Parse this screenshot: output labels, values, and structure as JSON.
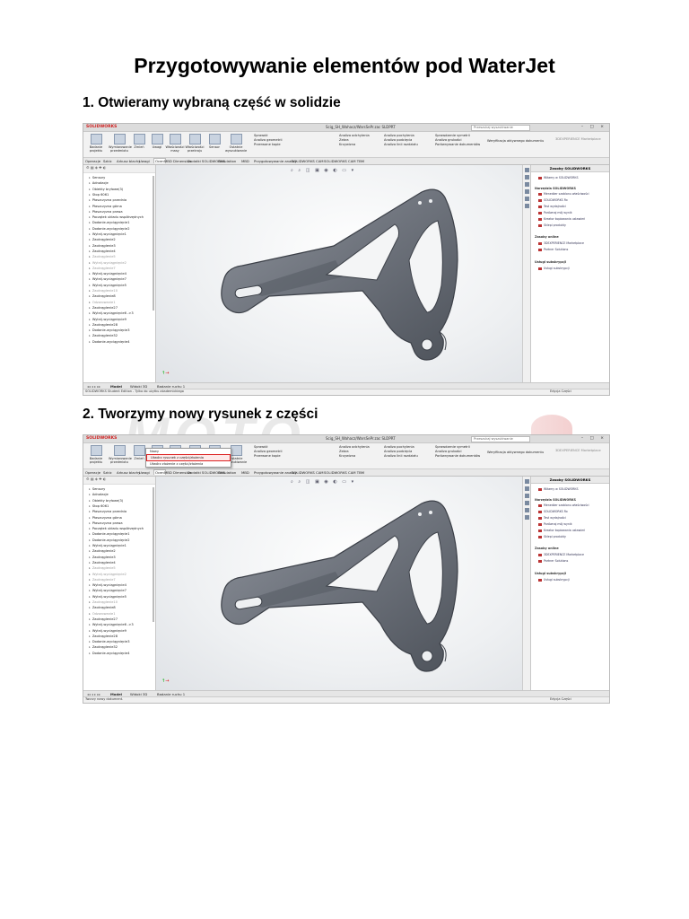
{
  "document": {
    "title": "Przygotowywanie elementów pod WaterJet",
    "steps": [
      {
        "heading": "1. Otwieramy wybraną część w solidzie"
      },
      {
        "heading": "2. Tworzymy nowy rysunek z części"
      }
    ],
    "watermark_text": "MOTO"
  },
  "app": {
    "logo": "SOLIDWORKS",
    "file_name": "Scig_SH_Wahacz/WarsSePr.zac SLDPRT",
    "search_placeholder": "Przeszukaj wyszukiwanie",
    "window_buttons": "– □ ×",
    "ribbon": {
      "big_buttons": [
        "Badanie projektu",
        "Wymiarowanie przedmiotu",
        "Zmień",
        "Uwagi",
        "Właściwości masy",
        "Właściwości przekroju",
        "Sensor",
        "Ostatnie wyszukiwanie"
      ],
      "col1": [
        "Sprawdź",
        "Analiza geometrii",
        "Przerwane kopie"
      ],
      "col2": [
        "Analiza odchylenia",
        "Zebra",
        "Krzywizna"
      ],
      "col3": [
        "Analiza pochylenia",
        "Analiza podcięcia",
        "Analiza linii rozdziału"
      ],
      "col4": [
        "Sprawdzenie symetrii",
        "Analiza grubości",
        "Porównywanie dokumentów"
      ],
      "extra": "Weryfikacja aktywnego dokumentu",
      "ext": "3DEXPERIENCE Marketplace"
    },
    "tabs": [
      "Operacje",
      "Szkic",
      "Arkusz blachy",
      "Uwagi",
      "Ocen",
      "MBD Dimension",
      "Dodatki SOLIDWORKS",
      "Simulation",
      "MBD",
      "Przygotowywanie analizy",
      "SOLIDWORKS CAM",
      "SOLIDWORKS CAM TBM"
    ],
    "active_tab": "Ocen",
    "feature_tree": [
      {
        "label": "Sensory",
        "dim": false
      },
      {
        "label": "Adnotacje",
        "dim": false
      },
      {
        "label": "Obiekty bryłowe(3)",
        "dim": false
      },
      {
        "label": "Stop 6061",
        "dim": false
      },
      {
        "label": "Płaszczyzna przednia",
        "dim": false
      },
      {
        "label": "Płaszczyzna górna",
        "dim": false
      },
      {
        "label": "Płaszczyzna prawa",
        "dim": false
      },
      {
        "label": "Początek układu współrzędnych",
        "dim": false
      },
      {
        "label": "Dodanie-wyciągnięcie1",
        "dim": false
      },
      {
        "label": "Dodanie-wyciągnięcie2",
        "dim": false
      },
      {
        "label": "Wytnij-wyciągnięcie1",
        "dim": false
      },
      {
        "label": "Zaokrąglenie2",
        "dim": false
      },
      {
        "label": "Zaokrąglenie3",
        "dim": false
      },
      {
        "label": "Zaokrąglenie4",
        "dim": false
      },
      {
        "label": "Zaokrąglenie5",
        "dim": true
      },
      {
        "label": "Wytnij-wyciągnięcie2",
        "dim": true
      },
      {
        "label": "Zaokrąglenie7",
        "dim": true
      },
      {
        "label": "Wytnij-wyciągnięcie4",
        "dim": false
      },
      {
        "label": "Wytnij-wyciągnięcie7",
        "dim": false
      },
      {
        "label": "Wytnij-wyciągnięcie5",
        "dim": false
      },
      {
        "label": "Zaokrąglenie10",
        "dim": true
      },
      {
        "label": "Zaokrąglenie8",
        "dim": false
      },
      {
        "label": "Odzorowanie1",
        "dim": true
      },
      {
        "label": "Zaokrąglenie27",
        "dim": false
      },
      {
        "label": "Wytnij-wyciągnięcie6 ->3",
        "dim": false
      },
      {
        "label": "Wytnij-wyciągnięcie9",
        "dim": false
      },
      {
        "label": "Zaokrąglenie28",
        "dim": false
      },
      {
        "label": "Dodanie-wyciągnięcie3",
        "dim": false
      },
      {
        "label": "Zaokrąglenie32",
        "dim": false
      },
      {
        "label": "Dodanie-wyciągnięcie4",
        "dim": false
      }
    ],
    "task_pane": {
      "title": "Zasoby SOLIDWORKS",
      "welcome": "Witamy w SOLIDWORKS",
      "sections": [
        {
          "title": "Narzędzia SOLIDWORKS",
          "items": [
            "Menedżer szablonu właściwości",
            "SOLIDWORKS Rx",
            "Test wydajności",
            "Porównaj mój wynik",
            "Kreator kopiowania ustawień",
            "Sklepi produkty"
          ]
        },
        {
          "title": "Zasoby online",
          "items": [
            "3DEXPERIENCE Marketplace",
            "Partner Solutions"
          ]
        },
        {
          "title": "Usługi subskrypcji",
          "items": [
            "Usługi subskrypcji"
          ]
        }
      ]
    },
    "bottom_tabs": [
      "Model",
      "Widoki 3D",
      "Badanie ruchu 1"
    ],
    "status_left_1": "SOLIDWORKS Student Edition - Tylko do użytku akademickiego",
    "status_left_2": "Tworzy nowy dokument.",
    "status_right": "Edycja Części",
    "dropdown_menu": [
      "Nowy",
      "Utwórz rysunek z części/złożenia",
      "Utwórz złożenie z części/złożenia"
    ],
    "dropdown_highlight": "Utwórz rysunek z części/złożenia"
  }
}
